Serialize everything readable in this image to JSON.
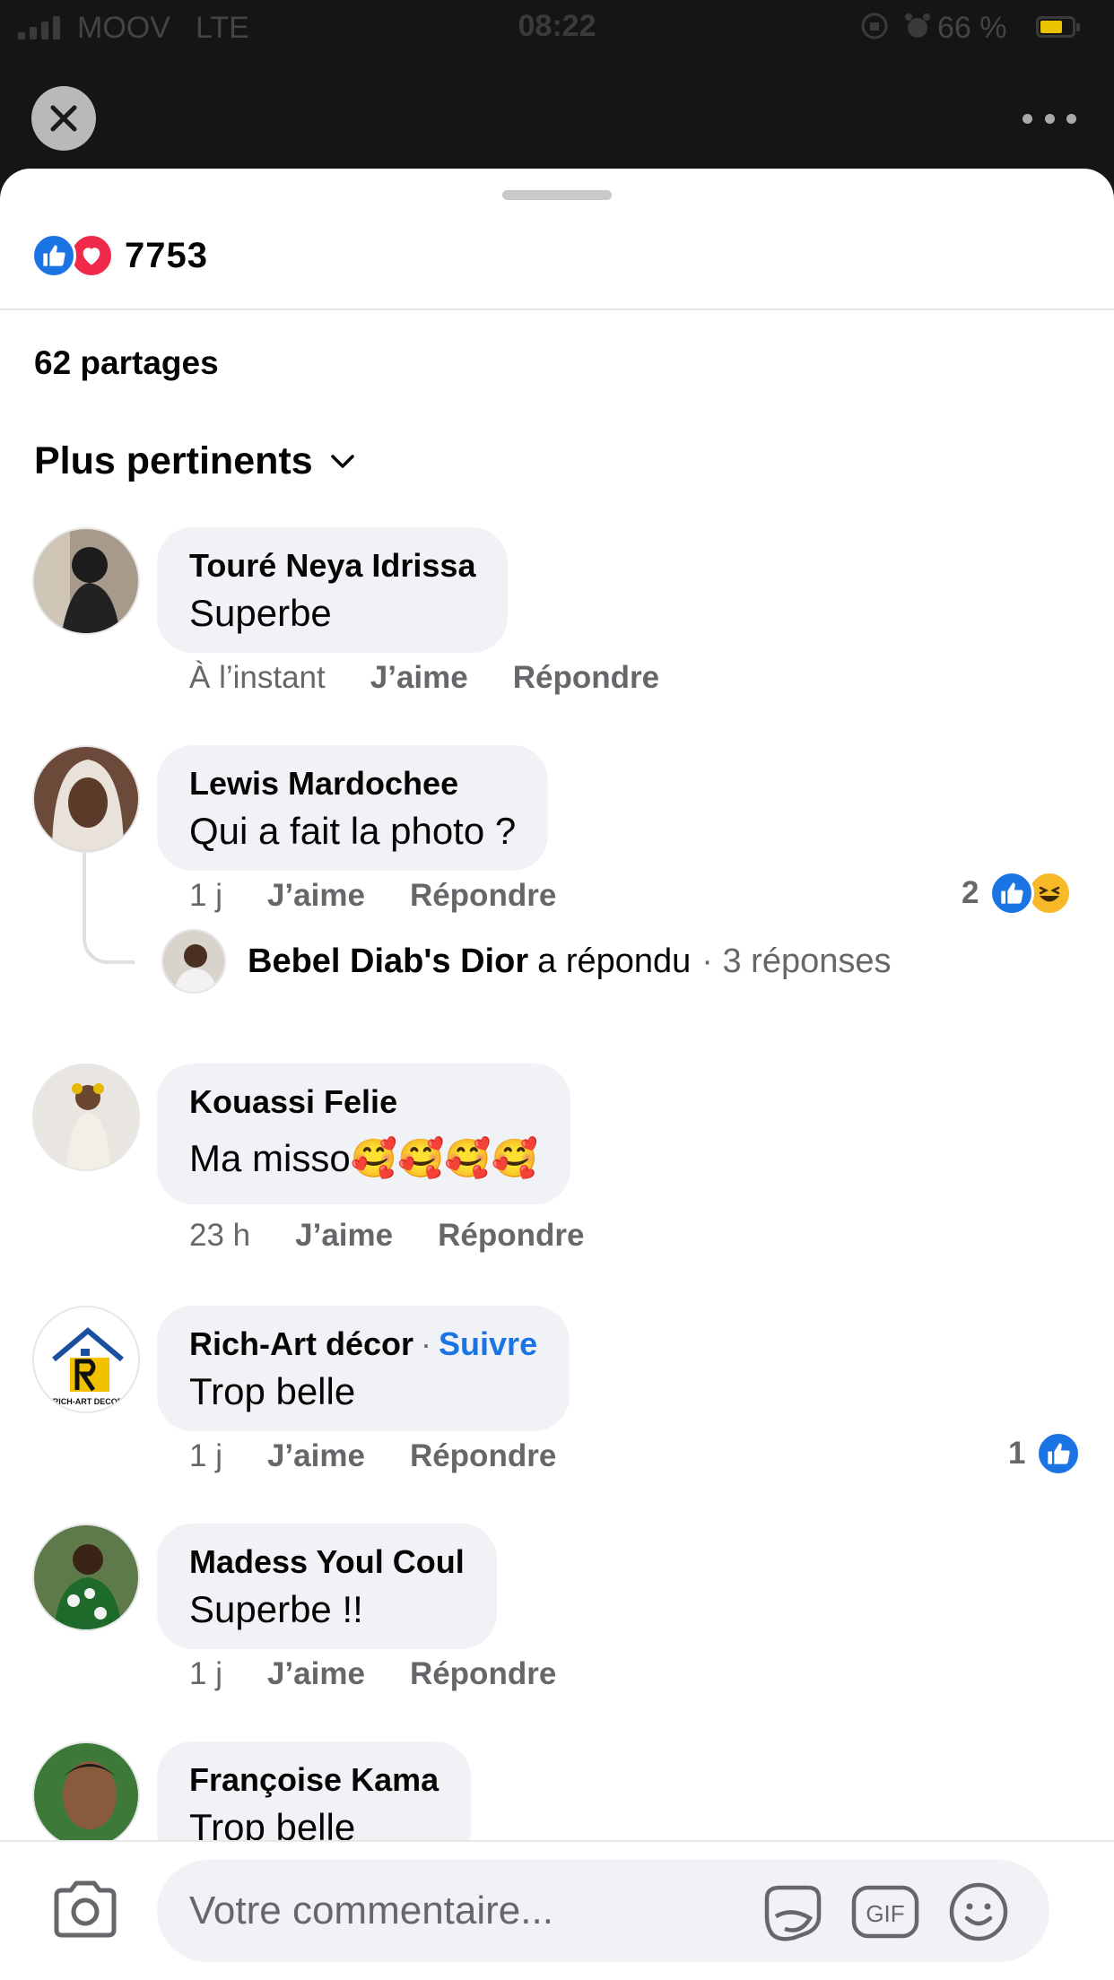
{
  "status_bar": {
    "carrier": "MOOV",
    "network": "LTE",
    "time": "08:22",
    "battery_percent": "66 %"
  },
  "icons": {
    "close": "close-icon",
    "more": "more-icon",
    "like": "like-icon",
    "love": "love-icon",
    "haha": "haha-icon",
    "chevron": "chevron-down-icon",
    "camera": "camera-icon",
    "sticker": "sticker-icon",
    "gif": "gif-icon",
    "emoji": "emoji-icon"
  },
  "post": {
    "reaction_count": "7753",
    "shares_label": "62 partages",
    "sort_label": "Plus pertinents"
  },
  "actions": {
    "like": "J’aime",
    "reply": "Répondre"
  },
  "comments": [
    {
      "author": "Touré Neya Idrissa",
      "text": "Superbe",
      "time": "À l’instant"
    },
    {
      "author": "Lewis Mardochee",
      "text": "Qui a fait la photo ?",
      "time": "1 j",
      "reaction_count": "2",
      "reply_summary": {
        "name": "Bebel Diab's Dior",
        "verb": "a répondu",
        "count": "· 3 réponses"
      }
    },
    {
      "author": "Kouassi Felie",
      "text": "Ma misso🥰🥰🥰🥰",
      "time": "23 h"
    },
    {
      "author": "Rich-Art décor",
      "follow": "Suivre",
      "text": "Trop belle",
      "time": "1 j",
      "reaction_count": "1"
    },
    {
      "author": "Madess Youl Coul",
      "text": "Superbe !!",
      "time": "1 j"
    },
    {
      "author": "Françoise Kama",
      "text": "Trop belle"
    }
  ],
  "composer": {
    "placeholder": "Votre commentaire...",
    "gif_label": "GIF"
  },
  "colors": {
    "accent": "#1b74e4",
    "love": "#f02849",
    "haha": "#f7b928",
    "bubble": "#f0f2f5",
    "secondary_text": "#65676b"
  }
}
